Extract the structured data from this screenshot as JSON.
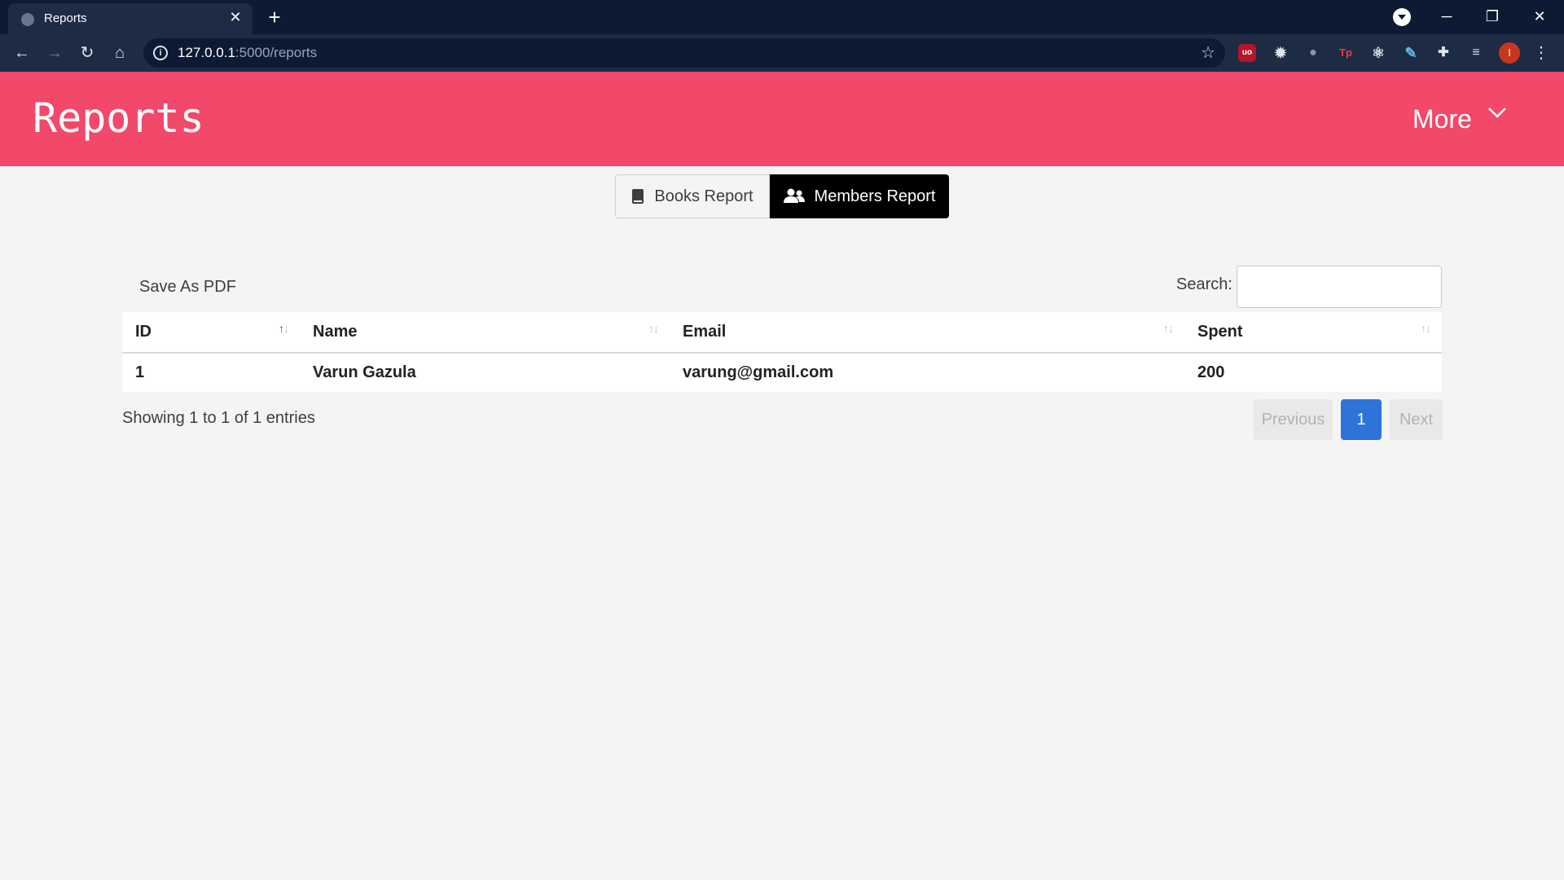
{
  "browser": {
    "tab_title": "Reports",
    "tab_close": "✕",
    "new_tab": "+",
    "url_host": "127.0.0.1",
    "url_rest": ":5000/reports",
    "profile_initial": "I",
    "window_controls": {
      "minimize": "─",
      "restore": "❐",
      "close": "✕"
    },
    "extensions": [
      "ublock-icon",
      "gear-icon",
      "bulb-icon",
      "tp-icon",
      "atom-icon",
      "wrench-icon",
      "puzzle-icon",
      "playlist-icon"
    ]
  },
  "header": {
    "brand": "Reports",
    "more_label": "More"
  },
  "report_tabs": {
    "books_label": "Books Report",
    "members_label": "Members Report",
    "active": "members"
  },
  "tools": {
    "save_pdf": "Save As PDF",
    "search_label": "Search:",
    "search_value": ""
  },
  "table": {
    "columns": [
      "ID",
      "Name",
      "Email",
      "Spent"
    ],
    "rows": [
      {
        "id": "1",
        "name": "Varun Gazula",
        "email": "varung@gmail.com",
        "spent": "200"
      }
    ]
  },
  "footer": {
    "info": "Showing 1 to 1 of 1 entries",
    "previous": "Previous",
    "current_page": "1",
    "next": "Next"
  },
  "colors": {
    "header": "#f2486a",
    "active_tab": "#000000",
    "pager_current": "#2d73d8",
    "chrome_dark": "#0d1a33",
    "chrome_mid": "#1e2b45"
  }
}
